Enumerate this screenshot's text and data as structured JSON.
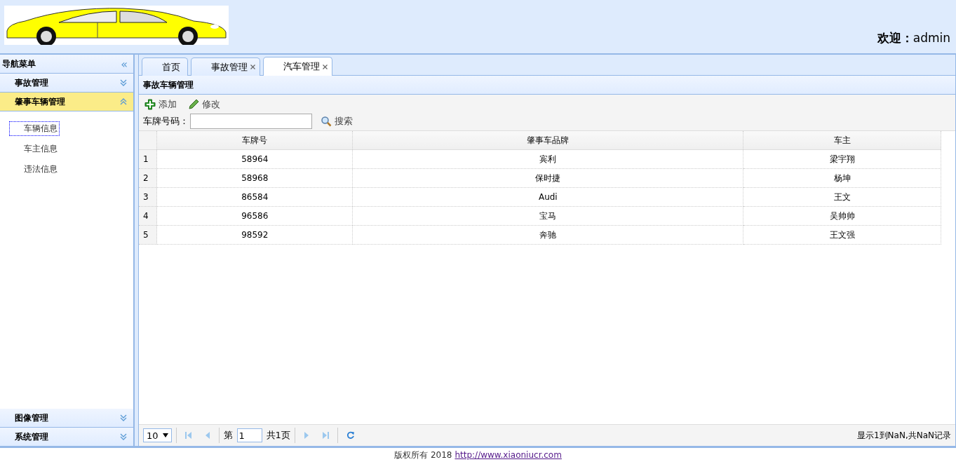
{
  "header": {
    "welcome": "**欢迎：**admin"
  },
  "sidebar": {
    "title": "导航菜单",
    "collapse_icon": "«",
    "panels": [
      {
        "title": "事故管理",
        "expanded": false
      },
      {
        "title": "肇事车辆管理",
        "expanded": true,
        "items": [
          {
            "label": "车辆信息",
            "selected": true
          },
          {
            "label": "车主信息",
            "selected": false
          },
          {
            "label": "违法信息",
            "selected": false
          }
        ]
      }
    ],
    "bottom_panels": [
      {
        "title": "图像管理",
        "expanded": false
      },
      {
        "title": "系统管理",
        "expanded": false
      }
    ]
  },
  "tabs": [
    {
      "label": "首页",
      "selected": false,
      "closable": false
    },
    {
      "label": "事故管理",
      "selected": false,
      "closable": true
    },
    {
      "label": "汽车管理",
      "selected": true,
      "closable": true
    }
  ],
  "panel": {
    "title": "事故车辆管理",
    "toolbar": [
      {
        "kind": "add",
        "label": "添加"
      },
      {
        "kind": "edit",
        "label": "修改"
      }
    ],
    "search": {
      "label": "车牌号码：",
      "button": "搜索"
    },
    "table": {
      "columns": [
        "",
        "车牌号",
        "肇事车品牌",
        "车主"
      ],
      "rows": [
        [
          "1",
          "58964",
          "宾利",
          "梁宇翔"
        ],
        [
          "2",
          "58968",
          "保时捷",
          "杨坤"
        ],
        [
          "3",
          "86584",
          "Audi",
          "王文"
        ],
        [
          "4",
          "96586",
          "宝马",
          "吴帅帅"
        ],
        [
          "5",
          "98592",
          "奔驰",
          "王文强"
        ]
      ]
    },
    "pager": {
      "page_size": "10",
      "page_label": "第",
      "page": "1",
      "total_pages": "共1页",
      "summary": "显示1到NaN,共NaN记录"
    }
  },
  "footer": {
    "text": "版权所有 2018",
    "link": "http://www.xiaoniucr.com"
  }
}
